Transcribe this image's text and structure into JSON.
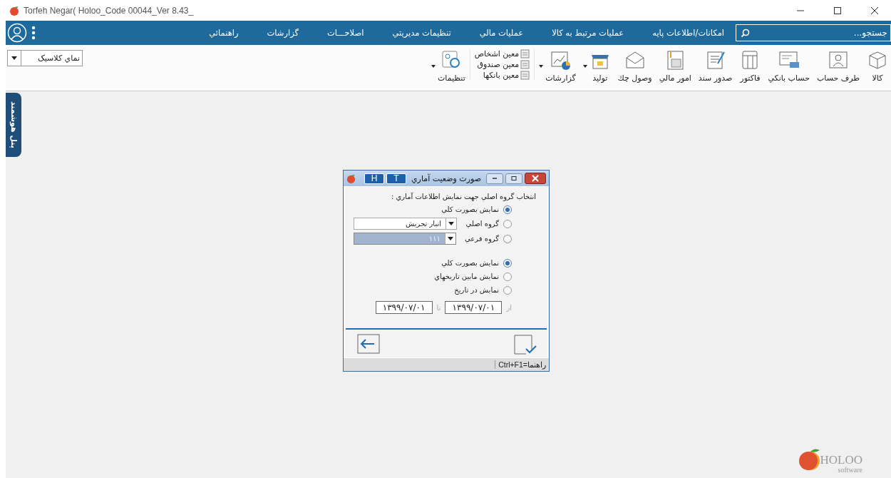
{
  "window": {
    "title": "Torfeh Negar( Holoo_Code 00044_Ver 8.43_"
  },
  "menu": [
    "امکانات/اطلاعات پايه",
    "عمليات مرتبط به کالا",
    "عمليات مالي",
    "تنظيمات مديريتي",
    "اصلاحـــات",
    "گزارشات",
    "راهنمائي"
  ],
  "search": {
    "placeholder": "جستجو..."
  },
  "view_select": {
    "value": "نماي کلاسيک"
  },
  "toolbar": [
    {
      "kind": "tool",
      "label": "کالا",
      "dropdown": false
    },
    {
      "kind": "tool",
      "label": "طرف حساب",
      "dropdown": false
    },
    {
      "kind": "tool",
      "label": "حساب بانکي",
      "dropdown": false
    },
    {
      "kind": "tool",
      "label": "فاکتور",
      "dropdown": false
    },
    {
      "kind": "tool",
      "label": "صدور سند",
      "dropdown": false
    },
    {
      "kind": "tool",
      "label": "امور مالي",
      "dropdown": false
    },
    {
      "kind": "tool",
      "label": "وصول چك",
      "dropdown": false
    },
    {
      "kind": "tool",
      "label": "توليد",
      "dropdown": true
    },
    {
      "kind": "tool",
      "label": "گزارشات",
      "dropdown": true
    },
    {
      "kind": "stack",
      "items": [
        "معين اشخاص",
        "معين صندوق",
        "معين بانكها"
      ]
    },
    {
      "kind": "tool",
      "label": "تنظيمات",
      "dropdown": true
    }
  ],
  "side_panel": {
    "label": "پنل هوشمند"
  },
  "dialog": {
    "title": "صورت وضعيت آماري",
    "title_buttons": [
      "T",
      "H"
    ],
    "prompt": "انتخاب گروه اصلي جهت نمايش اطلاعات آماري :",
    "group_options": [
      {
        "label": "نمايش بصورت کلي",
        "selected": true
      },
      {
        "label": "گروه اصلي",
        "selected": false,
        "select": {
          "value": "انبار تجريش",
          "disabled": false
        }
      },
      {
        "label": "گروه فرعي",
        "selected": false,
        "select": {
          "value": "۱۱۱",
          "disabled": true
        }
      }
    ],
    "date_options": [
      {
        "label": "نمايش بصورت کلي",
        "selected": true
      },
      {
        "label": "نمايش مابين تاريخهاي",
        "selected": false
      },
      {
        "label": "نمايش در تاريخ",
        "selected": false
      }
    ],
    "from_label": "از",
    "from_date": "۱۳۹۹/۰۷/۰۱",
    "to_label": "تا",
    "to_date": "۱۳۹۹/۰۷/۰۱",
    "status": "راهنما=Ctrl+F1"
  },
  "logo": {
    "name": "HOLOO",
    "tagline": "software"
  }
}
